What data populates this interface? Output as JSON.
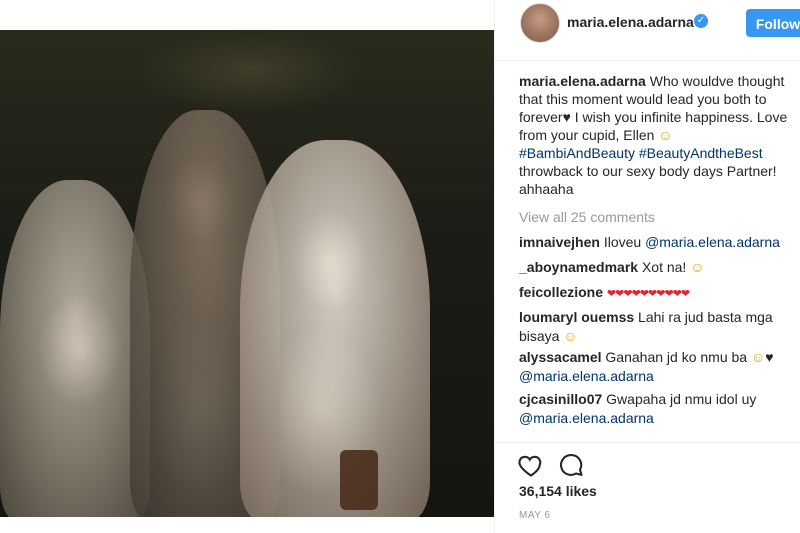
{
  "post": {
    "username": "maria.elena.adarna",
    "follow_label": "Follow",
    "caption_username": "maria.elena.adarna",
    "caption_text": "Who wouldve thought that this moment would lead you both to forever",
    "caption_text_2": "I wish you infinite happiness. Love from your cupid, Ellen",
    "caption_hashtags": "#BambiAndBeauty #BeautyAndtheBest",
    "caption_text_3": "throwback to our sexy body days Partner! ahhaaha",
    "view_all": "View all 25 comments",
    "likes": "36,154 likes",
    "date": "MAY 6"
  },
  "comments": [
    {
      "user": "imnaivejhen",
      "text": "Iloveu",
      "mention": "@maria.elena.adarna"
    },
    {
      "user": "_aboynamedmark",
      "text": "Xot na!"
    },
    {
      "user": "feicollezione",
      "text": ""
    },
    {
      "user": "loumaryl ouemss",
      "text": "Lahi ra jud basta mga bisaya"
    },
    {
      "user": "alyssacamel",
      "text": "Ganahan jd ko nmu ba",
      "mention": "@maria.elena.adarna"
    },
    {
      "user": "cjcasinillo07",
      "text": "Gwapaha jd nmu idol uy",
      "mention": "@maria.elena.adarna"
    }
  ],
  "colors": {
    "accent": "#3897f0",
    "link": "#003569",
    "muted": "#999999"
  }
}
